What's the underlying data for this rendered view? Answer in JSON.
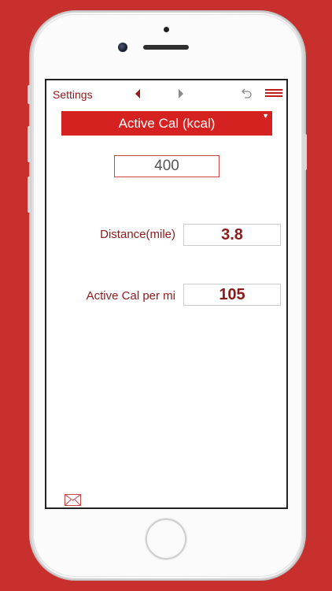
{
  "topbar": {
    "settings_label": "Settings",
    "nav_prev_icon": "triangle-left-icon",
    "nav_next_icon": "triangle-right-icon",
    "undo_icon": "undo-icon",
    "menu_icon": "hamburger-menu-icon"
  },
  "dropdown": {
    "selected": "Active Cal (kcal)",
    "arrow": "▼"
  },
  "input": {
    "value": "400"
  },
  "results": [
    {
      "label": "Distance(mile)",
      "value": "3.8"
    },
    {
      "label": "Active Cal per mi",
      "value": "105"
    }
  ],
  "footer": {
    "mail_icon": "mail-icon"
  },
  "colors": {
    "background": "#c8302e",
    "accent": "#d52120",
    "text": "#8b1a1a"
  }
}
